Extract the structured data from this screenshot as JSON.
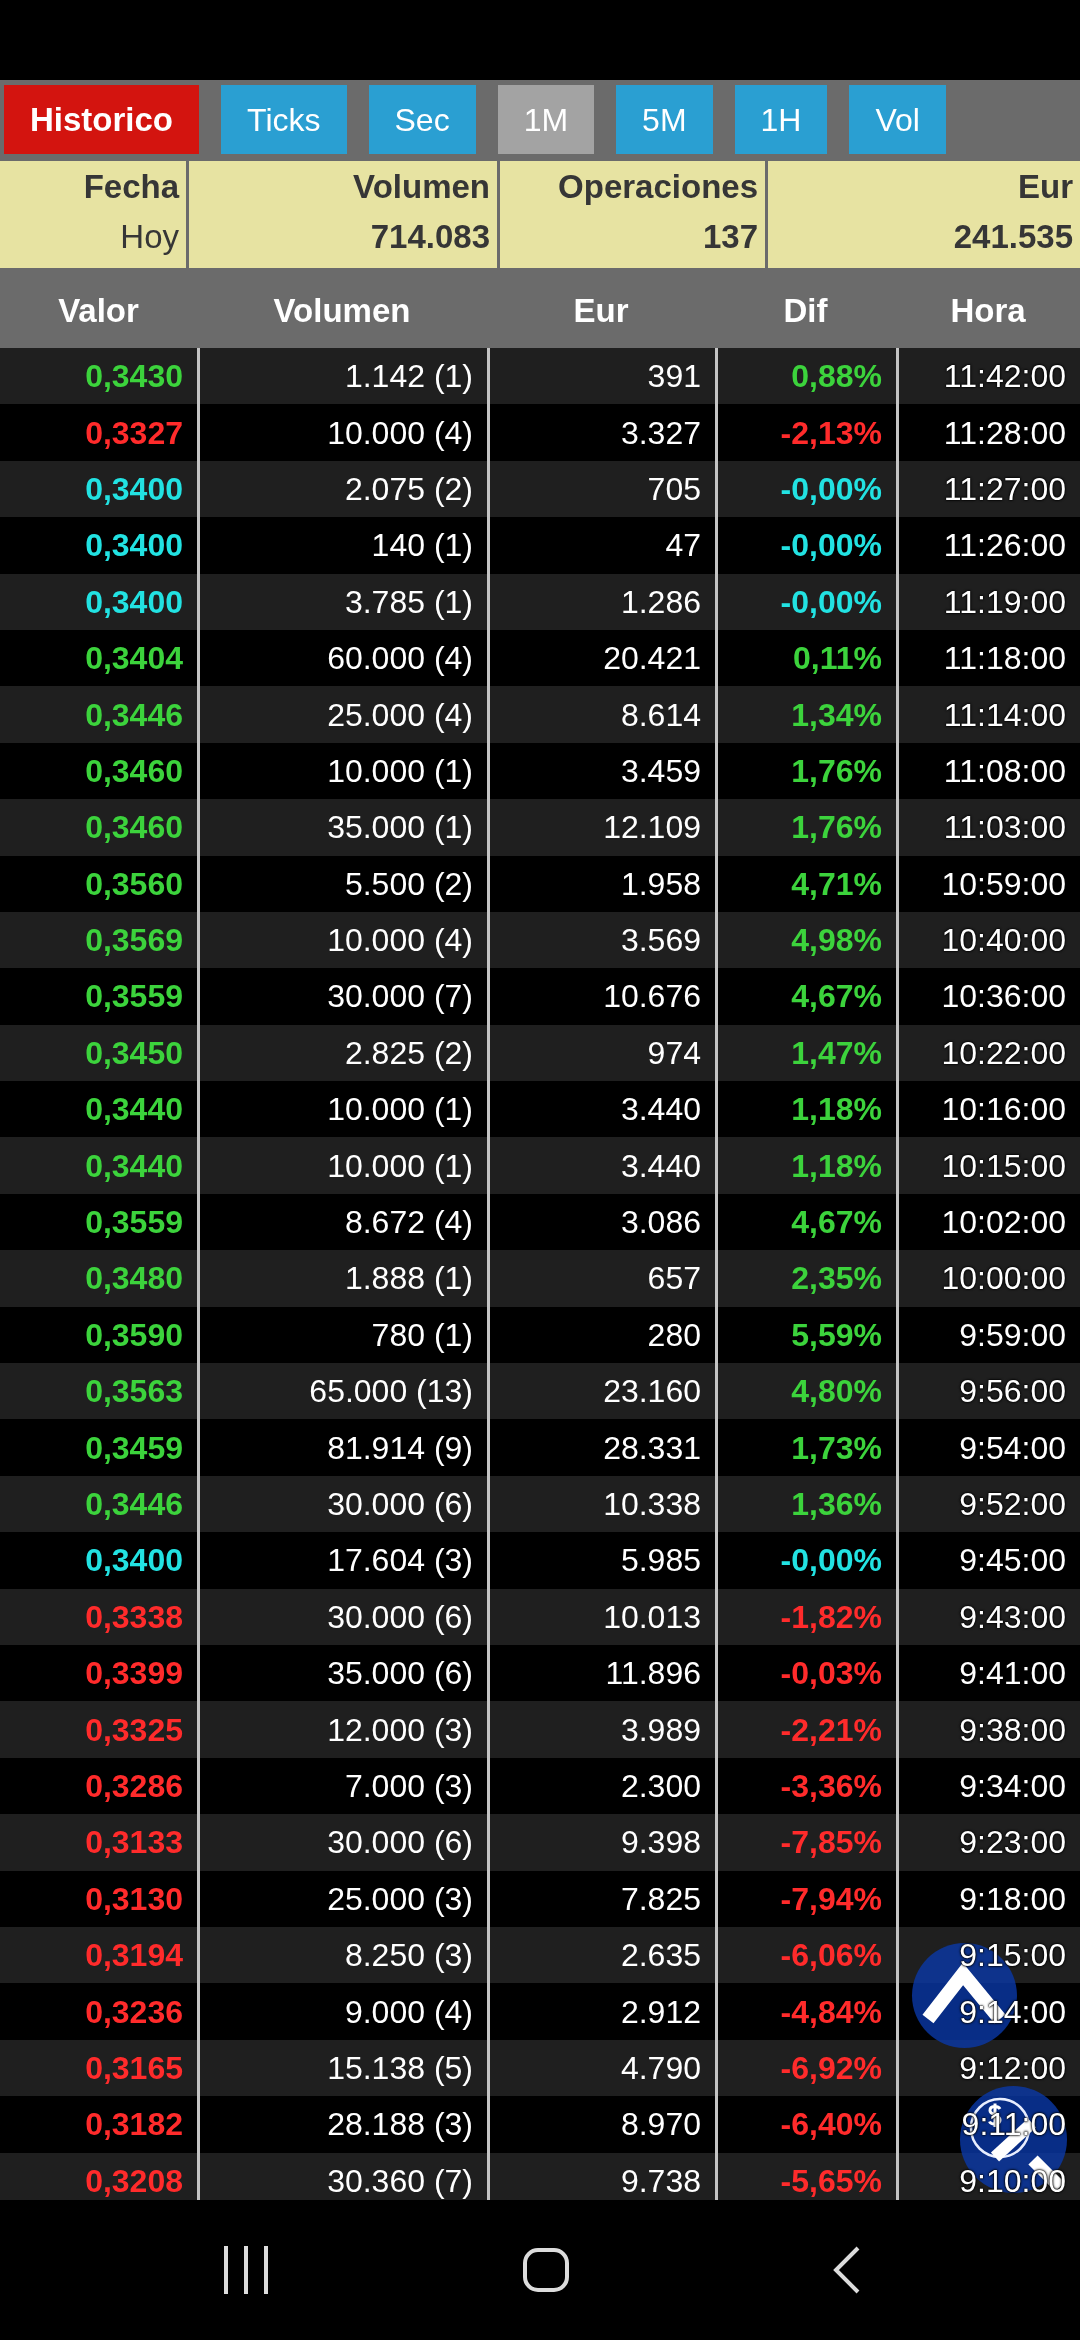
{
  "history_button": {
    "label": "Historico",
    "active": true
  },
  "intervals": [
    {
      "label": "Ticks",
      "selected": false
    },
    {
      "label": "Sec",
      "selected": false
    },
    {
      "label": "1M",
      "selected": true
    },
    {
      "label": "5M",
      "selected": false
    },
    {
      "label": "1H",
      "selected": false
    },
    {
      "label": "Vol",
      "selected": false
    }
  ],
  "summary": [
    {
      "label": "Fecha",
      "value": "Hoy",
      "kind": "date"
    },
    {
      "label": "Volumen",
      "value": "714.083",
      "kind": "amount"
    },
    {
      "label": "Operaciones",
      "value": "137",
      "kind": "amount"
    },
    {
      "label": "Eur",
      "value": "241.535",
      "kind": "amount"
    }
  ],
  "table": {
    "columns": [
      "Valor",
      "Volumen",
      "Eur",
      "Dif",
      "Hora"
    ],
    "rows": [
      {
        "valor": "0,3430",
        "volumen": "1.142 (1)",
        "eur": "391",
        "dif": "0,88%",
        "hora": "11:42:00",
        "color": "#3cd33c"
      },
      {
        "valor": "0,3327",
        "volumen": "10.000 (4)",
        "eur": "3.327",
        "dif": "-2,13%",
        "hora": "11:28:00",
        "color": "#ff2b2b"
      },
      {
        "valor": "0,3400",
        "volumen": "2.075 (2)",
        "eur": "705",
        "dif": "-0,00%",
        "hora": "11:27:00",
        "color": "#22e2e2"
      },
      {
        "valor": "0,3400",
        "volumen": "140 (1)",
        "eur": "47",
        "dif": "-0,00%",
        "hora": "11:26:00",
        "color": "#22e2e2"
      },
      {
        "valor": "0,3400",
        "volumen": "3.785 (1)",
        "eur": "1.286",
        "dif": "-0,00%",
        "hora": "11:19:00",
        "color": "#22e2e2"
      },
      {
        "valor": "0,3404",
        "volumen": "60.000 (4)",
        "eur": "20.421",
        "dif": "0,11%",
        "hora": "11:18:00",
        "color": "#3cd33c"
      },
      {
        "valor": "0,3446",
        "volumen": "25.000 (4)",
        "eur": "8.614",
        "dif": "1,34%",
        "hora": "11:14:00",
        "color": "#3cd33c"
      },
      {
        "valor": "0,3460",
        "volumen": "10.000 (1)",
        "eur": "3.459",
        "dif": "1,76%",
        "hora": "11:08:00",
        "color": "#3cd33c"
      },
      {
        "valor": "0,3460",
        "volumen": "35.000 (1)",
        "eur": "12.109",
        "dif": "1,76%",
        "hora": "11:03:00",
        "color": "#3cd33c"
      },
      {
        "valor": "0,3560",
        "volumen": "5.500 (2)",
        "eur": "1.958",
        "dif": "4,71%",
        "hora": "10:59:00",
        "color": "#3cd33c"
      },
      {
        "valor": "0,3569",
        "volumen": "10.000 (4)",
        "eur": "3.569",
        "dif": "4,98%",
        "hora": "10:40:00",
        "color": "#3cd33c"
      },
      {
        "valor": "0,3559",
        "volumen": "30.000 (7)",
        "eur": "10.676",
        "dif": "4,67%",
        "hora": "10:36:00",
        "color": "#3cd33c"
      },
      {
        "valor": "0,3450",
        "volumen": "2.825 (2)",
        "eur": "974",
        "dif": "1,47%",
        "hora": "10:22:00",
        "color": "#3cd33c"
      },
      {
        "valor": "0,3440",
        "volumen": "10.000 (1)",
        "eur": "3.440",
        "dif": "1,18%",
        "hora": "10:16:00",
        "color": "#3cd33c"
      },
      {
        "valor": "0,3440",
        "volumen": "10.000 (1)",
        "eur": "3.440",
        "dif": "1,18%",
        "hora": "10:15:00",
        "color": "#3cd33c"
      },
      {
        "valor": "0,3559",
        "volumen": "8.672 (4)",
        "eur": "3.086",
        "dif": "4,67%",
        "hora": "10:02:00",
        "color": "#3cd33c"
      },
      {
        "valor": "0,3480",
        "volumen": "1.888 (1)",
        "eur": "657",
        "dif": "2,35%",
        "hora": "10:00:00",
        "color": "#3cd33c"
      },
      {
        "valor": "0,3590",
        "volumen": "780 (1)",
        "eur": "280",
        "dif": "5,59%",
        "hora": "9:59:00",
        "color": "#3cd33c"
      },
      {
        "valor": "0,3563",
        "volumen": "65.000 (13)",
        "eur": "23.160",
        "dif": "4,80%",
        "hora": "9:56:00",
        "color": "#3cd33c"
      },
      {
        "valor": "0,3459",
        "volumen": "81.914 (9)",
        "eur": "28.331",
        "dif": "1,73%",
        "hora": "9:54:00",
        "color": "#3cd33c"
      },
      {
        "valor": "0,3446",
        "volumen": "30.000 (6)",
        "eur": "10.338",
        "dif": "1,36%",
        "hora": "9:52:00",
        "color": "#3cd33c"
      },
      {
        "valor": "0,3400",
        "volumen": "17.604 (3)",
        "eur": "5.985",
        "dif": "-0,00%",
        "hora": "9:45:00",
        "color": "#22e2e2"
      },
      {
        "valor": "0,3338",
        "volumen": "30.000 (6)",
        "eur": "10.013",
        "dif": "-1,82%",
        "hora": "9:43:00",
        "color": "#ff2b2b"
      },
      {
        "valor": "0,3399",
        "volumen": "35.000 (6)",
        "eur": "11.896",
        "dif": "-0,03%",
        "hora": "9:41:00",
        "color": "#ff2b2b"
      },
      {
        "valor": "0,3325",
        "volumen": "12.000 (3)",
        "eur": "3.989",
        "dif": "-2,21%",
        "hora": "9:38:00",
        "color": "#ff2b2b"
      },
      {
        "valor": "0,3286",
        "volumen": "7.000 (3)",
        "eur": "2.300",
        "dif": "-3,36%",
        "hora": "9:34:00",
        "color": "#ff2b2b"
      },
      {
        "valor": "0,3133",
        "volumen": "30.000 (6)",
        "eur": "9.398",
        "dif": "-7,85%",
        "hora": "9:23:00",
        "color": "#ff2b2b"
      },
      {
        "valor": "0,3130",
        "volumen": "25.000 (3)",
        "eur": "7.825",
        "dif": "-7,94%",
        "hora": "9:18:00",
        "color": "#ff2b2b"
      },
      {
        "valor": "0,3194",
        "volumen": "8.250 (3)",
        "eur": "2.635",
        "dif": "-6,06%",
        "hora": "9:15:00",
        "color": "#ff2b2b"
      },
      {
        "valor": "0,3236",
        "volumen": "9.000 (4)",
        "eur": "2.912",
        "dif": "-4,84%",
        "hora": "9:14:00",
        "color": "#ff2b2b"
      },
      {
        "valor": "0,3165",
        "volumen": "15.138 (5)",
        "eur": "4.790",
        "dif": "-6,92%",
        "hora": "9:12:00",
        "color": "#ff2b2b"
      },
      {
        "valor": "0,3182",
        "volumen": "28.188 (3)",
        "eur": "8.970",
        "dif": "-6,40%",
        "hora": "9:11:00",
        "color": "#ff2b2b"
      },
      {
        "valor": "0,3208",
        "volumen": "30.360 (7)",
        "eur": "9.738",
        "dif": "-5,65%",
        "hora": "9:10:00",
        "color": "#ff2b2b"
      }
    ]
  }
}
